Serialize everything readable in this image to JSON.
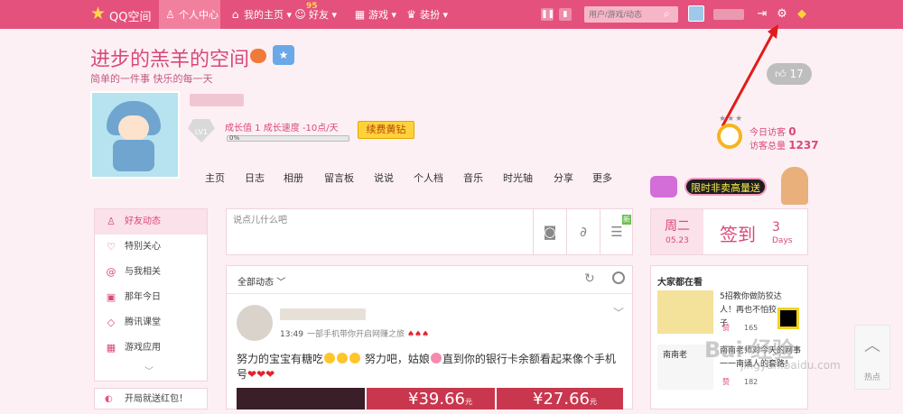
{
  "topbar": {
    "logo_text": "QQ空间",
    "items": [
      {
        "label": "个人中心",
        "icon": "person-icon"
      },
      {
        "label": "我的主页",
        "icon": "home-icon",
        "suffix": "▾"
      },
      {
        "label": "好友",
        "icon": "friends-icon",
        "badge": "95",
        "suffix": "▾"
      },
      {
        "label": "游戏",
        "icon": "grid-icon",
        "suffix": "▾"
      },
      {
        "label": "装扮",
        "icon": "shirt-icon",
        "suffix": "▾"
      }
    ],
    "search_placeholder": "用户/游戏/动态"
  },
  "header": {
    "title": "进步的羔羊的空间",
    "subtitle": "简单的一件事 快乐的每一天",
    "like_count": "17"
  },
  "profile": {
    "level": "LV1",
    "growth_text": "成长值 1   成长速度 -10点/天",
    "progress_percent": 0,
    "progress_label": "0%",
    "renew_button": "续费黄钻"
  },
  "visitors": {
    "today_label": "今日访客",
    "today_value": "0",
    "total_label": "访客总量",
    "total_value": "1237"
  },
  "nav": [
    "主页",
    "日志",
    "相册",
    "留言板",
    "说说",
    "个人档",
    "音乐",
    "时光轴",
    "分享",
    "更多"
  ],
  "left_menu": [
    {
      "label": "好友动态",
      "icon": "friends-icon",
      "active": true
    },
    {
      "label": "特别关心",
      "icon": "heart-icon",
      "active": false
    },
    {
      "label": "与我相关",
      "icon": "at-icon",
      "active": false
    },
    {
      "label": "那年今日",
      "icon": "calendar-icon",
      "active": false
    },
    {
      "label": "腾讯课堂",
      "icon": "graduation-icon",
      "active": false
    },
    {
      "label": "游戏应用",
      "icon": "apps-icon",
      "active": false
    }
  ],
  "red_packet": "开局就送红包！",
  "composer": {
    "placeholder": "说点儿什么吧",
    "new_badge": "新"
  },
  "feed": {
    "filter_label": "全部动态",
    "post": {
      "time": "13:49",
      "source": "一部手机带你开启网赚之旅",
      "text_before": "努力的宝宝有糖吃",
      "text_mid": " 努力吧，姑娘",
      "text_after": "直到你的银行卡余额看起来像个手机号",
      "price1": "39.66",
      "price2": "27.66",
      "unit": "元"
    }
  },
  "ad": {
    "text": "限时非卖高量送"
  },
  "signin": {
    "weekday": "周二",
    "date": "05.23",
    "label": "签到",
    "count": "3",
    "days": "Days"
  },
  "trending": {
    "title": "大家都在看",
    "items": [
      {
        "text": "5招教你做防狡达人！再也不怕狡子",
        "zan": "赞",
        "views": "165"
      },
      {
        "text": "南南老师对今天的网事一一南诵人的套路！",
        "zan": "赞",
        "views": "182"
      }
    ],
    "item2_thumb_label": "南南老"
  },
  "hot_button": "热点",
  "watermark": {
    "main": "Bai 经验",
    "sub": "jingyan.baidu.com"
  },
  "colors": {
    "brand": "#e4517c",
    "accent": "#d8497a",
    "gold": "#ffd23a"
  }
}
